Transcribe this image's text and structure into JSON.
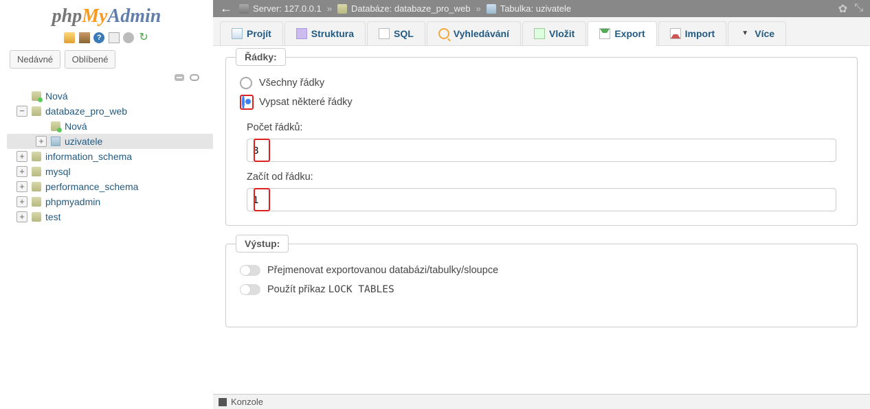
{
  "logo": {
    "p1": "php",
    "p2": "My",
    "p3": "Admin"
  },
  "sidebar": {
    "tabs": {
      "recent": "Nedávné",
      "favorite": "Oblíbené"
    },
    "tree": {
      "new_db": "Nová",
      "db_web": "databaze_pro_web",
      "db_web_new": "Nová",
      "db_web_table": "uzivatele",
      "info_schema": "information_schema",
      "mysql": "mysql",
      "perf_schema": "performance_schema",
      "pma": "phpmyadmin",
      "test": "test"
    }
  },
  "breadcrumb": {
    "server_label": "Server:",
    "server_value": "127.0.0.1",
    "db_label": "Databáze:",
    "db_value": "databaze_pro_web",
    "table_label": "Tabulka:",
    "table_value": "uzivatele"
  },
  "tabs": {
    "browse": "Projít",
    "structure": "Struktura",
    "sql": "SQL",
    "search": "Vyhledávání",
    "insert": "Vložit",
    "export": "Export",
    "import": "Import",
    "more": "Více"
  },
  "rows_box": {
    "legend": "Řádky:",
    "opt_all": "Všechny řádky",
    "opt_some": "Vypsat některé řádky",
    "count_label": "Počet řádků:",
    "count_value": "3",
    "start_label": "Začít od řádku:",
    "start_value": "1"
  },
  "output_box": {
    "legend": "Výstup:",
    "rename": "Přejmenovat exportovanou databázi/tabulky/sloupce",
    "lock_pre": "Použít příkaz ",
    "lock_code": "LOCK TABLES"
  },
  "console": {
    "label": "Konzole"
  },
  "help_char": "?"
}
